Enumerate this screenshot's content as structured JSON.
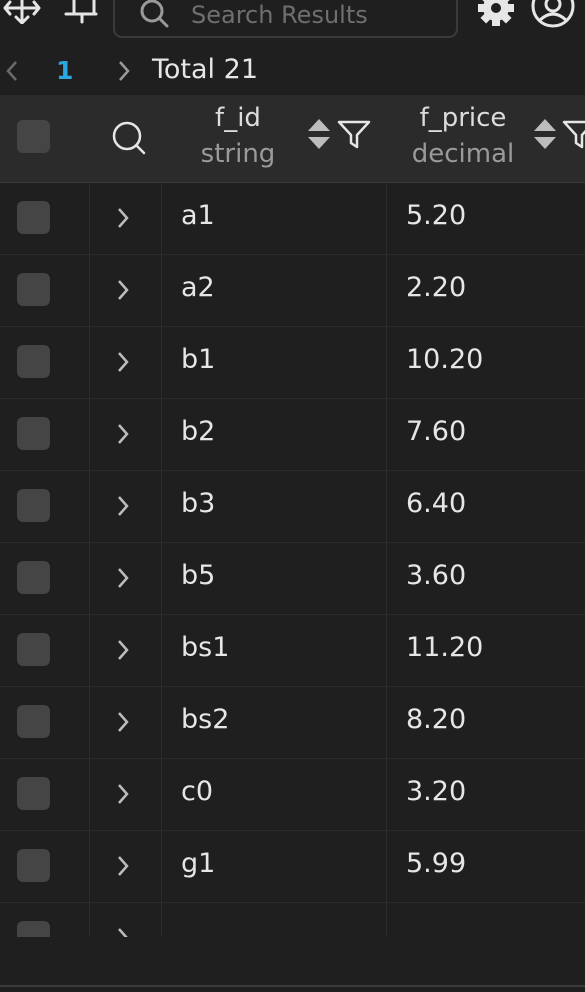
{
  "toolbar": {
    "search_placeholder": "Search Results",
    "icons": [
      "move-icon",
      "pin-icon",
      "search-icon",
      "gear-icon",
      "user-icon"
    ]
  },
  "pager": {
    "current_page": "1",
    "total_label": "Total 21"
  },
  "table": {
    "columns": [
      {
        "name": "f_id",
        "type": "string"
      },
      {
        "name": "f_price",
        "type": "decimal"
      }
    ],
    "rows": [
      {
        "f_id": "a1",
        "f_price": "5.20"
      },
      {
        "f_id": "a2",
        "f_price": "2.20"
      },
      {
        "f_id": "b1",
        "f_price": "10.20"
      },
      {
        "f_id": "b2",
        "f_price": "7.60"
      },
      {
        "f_id": "b3",
        "f_price": "6.40"
      },
      {
        "f_id": "b5",
        "f_price": "3.60"
      },
      {
        "f_id": "bs1",
        "f_price": "11.20"
      },
      {
        "f_id": "bs2",
        "f_price": "8.20"
      },
      {
        "f_id": "c0",
        "f_price": "3.20"
      },
      {
        "f_id": "g1",
        "f_price": "5.99"
      }
    ]
  },
  "colors": {
    "background": "#1f1f1f",
    "header_background": "#2b2b2b",
    "accent": "#2aa7df",
    "checkbox": "#454545"
  }
}
